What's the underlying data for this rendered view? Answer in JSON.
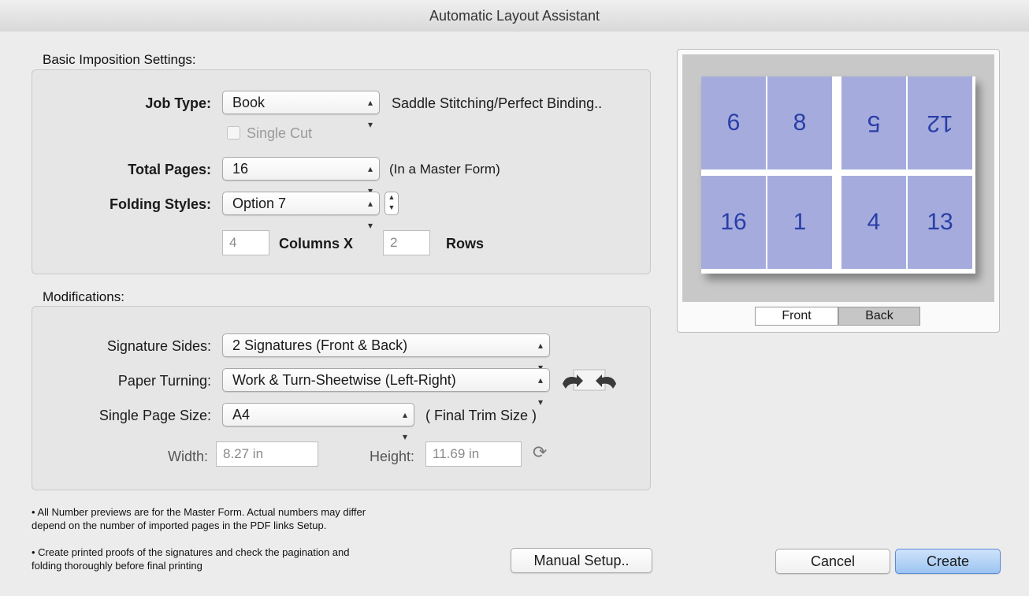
{
  "window": {
    "title": "Automatic Layout Assistant"
  },
  "basic": {
    "section_label": "Basic Imposition Settings:",
    "job_type": {
      "label": "Job Type:",
      "value": "Book",
      "note": "Saddle Stitching/Perfect Binding.."
    },
    "single_cut": {
      "label": "Single Cut",
      "checked": false,
      "enabled": false
    },
    "total_pages": {
      "label": "Total Pages:",
      "value": "16",
      "note": "(In a Master Form)"
    },
    "folding_styles": {
      "label": "Folding Styles:",
      "value": "Option 7"
    },
    "grid": {
      "columns_value": "4",
      "columns_label": "Columns X",
      "rows_value": "2",
      "rows_label": "Rows"
    }
  },
  "modifications": {
    "section_label": "Modifications:",
    "signature_sides": {
      "label": "Signature Sides:",
      "value": "2 Signatures (Front & Back)"
    },
    "paper_turning": {
      "label": "Paper Turning:",
      "value": "Work & Turn-Sheetwise (Left-Right)"
    },
    "single_page_size": {
      "label": "Single Page Size:",
      "value": "A4",
      "note": "( Final Trim Size )"
    },
    "width": {
      "label": "Width:",
      "value": "8.27 in"
    },
    "height": {
      "label": "Height:",
      "value": "11.69 in"
    }
  },
  "preview": {
    "pages": [
      {
        "number": "6",
        "upside_down": false
      },
      {
        "number": "8",
        "upside_down": false
      },
      {
        "number": "5",
        "upside_down": true
      },
      {
        "number": "12",
        "upside_down": true
      },
      {
        "number": "16",
        "upside_down": false
      },
      {
        "number": "1",
        "upside_down": false
      },
      {
        "number": "4",
        "upside_down": false
      },
      {
        "number": "13",
        "upside_down": false
      }
    ],
    "tabs": {
      "front": "Front",
      "back": "Back",
      "selected": "Back"
    },
    "cell_color": "#a5acdd",
    "number_color": "#2a3ea8"
  },
  "notes": {
    "line1": "• All Number previews are for the Master Form. Actual numbers may differ",
    "line2": "depend on the number of imported pages in the PDF links Setup.",
    "line3": "• Create printed proofs of the signatures and check the pagination and",
    "line4": "folding thoroughly before final printing"
  },
  "buttons": {
    "manual_setup": "Manual Setup..",
    "cancel": "Cancel",
    "create": "Create"
  }
}
